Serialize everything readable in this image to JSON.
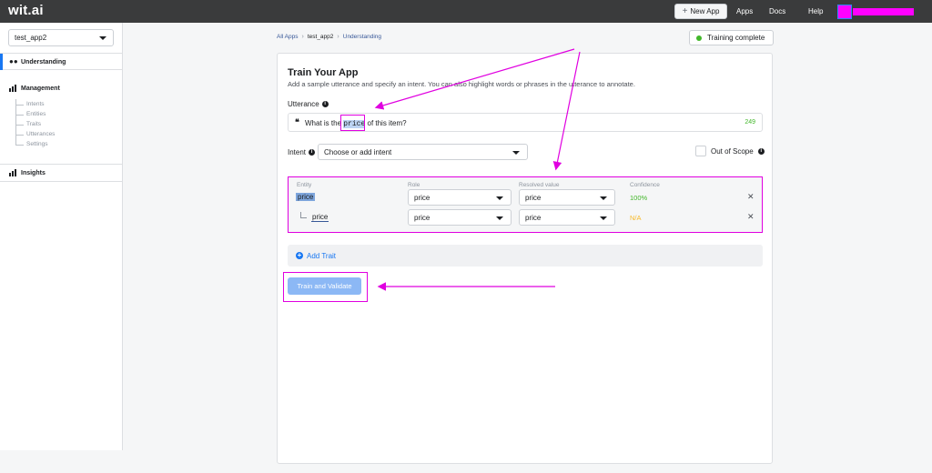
{
  "topbar": {
    "logo": "wit.ai",
    "new_app_label": "New App",
    "nav": [
      "Apps",
      "Docs",
      "Help"
    ]
  },
  "sidebar": {
    "app_name": "test_app2",
    "understanding_label": "Understanding",
    "management_label": "Management",
    "management_items": [
      "Intents",
      "Entities",
      "Traits",
      "Utterances",
      "Settings"
    ],
    "insights_label": "Insights"
  },
  "breadcrumb": [
    "All Apps",
    "test_app2",
    "Understanding"
  ],
  "status": {
    "text": "Training complete",
    "color": "#42b72a"
  },
  "panel": {
    "title": "Train Your App",
    "description": "Add a sample utterance and specify an intent. You can also highlight words or phrases in the utterance to annotate.",
    "utterance_label": "Utterance",
    "utterance_before": "What is the ",
    "utterance_highlight": "price",
    "utterance_after": " of this item?",
    "char_count": "249",
    "intent_label": "Intent",
    "intent_placeholder": "Choose or add intent",
    "out_of_scope_label": "Out of Scope",
    "table": {
      "headers": [
        "Entity",
        "Role",
        "Resolved value",
        "Confidence"
      ],
      "rows": [
        {
          "entity": "price",
          "role": "price",
          "resolved": "price",
          "confidence": "100%"
        },
        {
          "entity": "price",
          "role": "price",
          "resolved": "price",
          "confidence": "N/A"
        }
      ]
    },
    "add_trait_label": "Add Trait",
    "train_button": "Train and Validate"
  },
  "colors": {
    "accent": "#1877f2",
    "annotation": "#e000e0",
    "topbar": "#3a3b3c"
  }
}
